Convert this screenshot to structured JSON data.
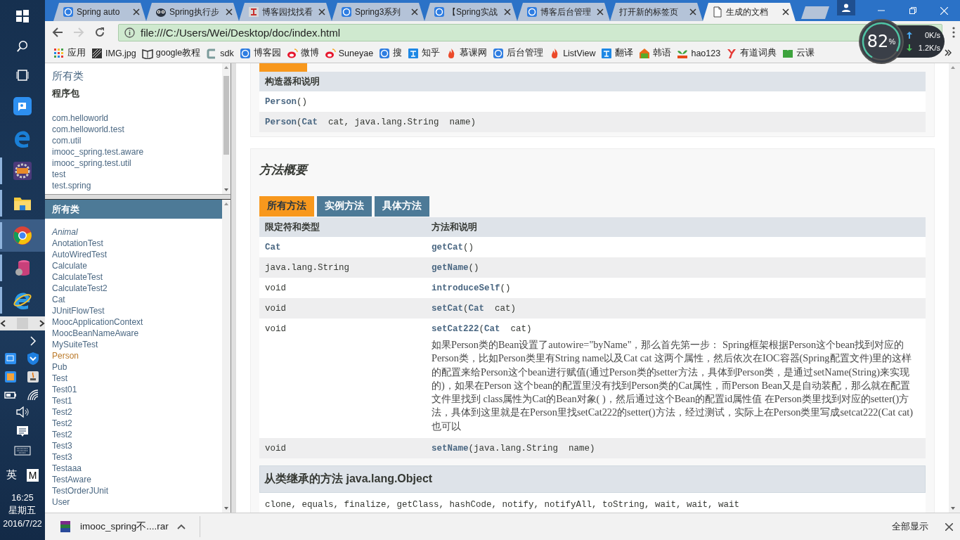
{
  "taskbar": {
    "apps": [
      {
        "running": false,
        "selected": false
      },
      {
        "running": false,
        "selected": false
      },
      {
        "running": true,
        "selected": false
      },
      {
        "running": true,
        "selected": false
      },
      {
        "running": true,
        "selected": true
      },
      {
        "running": true,
        "selected": false
      },
      {
        "running": true,
        "selected": false
      }
    ],
    "language": "英",
    "ime": "M",
    "time": "16:25",
    "weekday": "星期五",
    "date": "2016/7/22"
  },
  "tabs": [
    {
      "title": "Spring auto",
      "kind": "blog",
      "selected": false
    },
    {
      "title": "Spring执行步",
      "kind": "owl",
      "selected": false
    },
    {
      "title": "博客园找找看",
      "kind": "find",
      "selected": false
    },
    {
      "title": "Spring3系列",
      "kind": "blog",
      "selected": false
    },
    {
      "title": "【Spring实战",
      "kind": "blog",
      "selected": false
    },
    {
      "title": "博客后台管理",
      "kind": "blog",
      "selected": false
    },
    {
      "title": "打开新的标签页",
      "kind": "none",
      "selected": false
    },
    {
      "title": "生成的文档",
      "kind": "page",
      "selected": true
    }
  ],
  "address": {
    "value": "file:///C:/Users/Wei/Desktop/doc/index.html"
  },
  "bookmarks": [
    {
      "label": "应用",
      "kind": "apps"
    },
    {
      "label": "IMG.jpg",
      "kind": "image"
    },
    {
      "label": "google教程",
      "kind": "book"
    },
    {
      "label": "sdk",
      "kind": "bracket"
    },
    {
      "label": "博客园",
      "kind": "blog"
    },
    {
      "label": "微博",
      "kind": "eye"
    },
    {
      "label": "Suneyae",
      "kind": "eye"
    },
    {
      "label": "搜",
      "kind": "blog"
    },
    {
      "label": "知乎",
      "kind": "square"
    },
    {
      "label": "慕课网",
      "kind": "flame"
    },
    {
      "label": "后台管理",
      "kind": "blog"
    },
    {
      "label": "ListView",
      "kind": "flame"
    },
    {
      "label": "翻译",
      "kind": "square"
    },
    {
      "label": "韩语",
      "kind": "house"
    },
    {
      "label": "hao123",
      "kind": "leaf"
    },
    {
      "label": "有道词典",
      "kind": "y"
    },
    {
      "label": "云课",
      "kind": "greenbook"
    }
  ],
  "net_meter": {
    "percent": "82",
    "unit": "%",
    "upload": "0K/s",
    "download": "1.2K/s"
  },
  "package_frame": {
    "link": "所有类",
    "heading": "程序包",
    "packages": [
      "com.helloworld",
      "com.helloworld.test",
      "com.util",
      "imooc_spring.test.aware",
      "imooc_spring.test.util",
      "test",
      "test.spring"
    ]
  },
  "class_frame": {
    "heading": "所有类",
    "classes": [
      {
        "name": "Animal",
        "kind": "interface",
        "selected": false
      },
      {
        "name": "AnotationTest",
        "kind": "class",
        "selected": false
      },
      {
        "name": "AutoWiredTest",
        "kind": "class",
        "selected": false
      },
      {
        "name": "Calculate",
        "kind": "class",
        "selected": false
      },
      {
        "name": "CalculateTest",
        "kind": "class",
        "selected": false
      },
      {
        "name": "CalculateTest2",
        "kind": "class",
        "selected": false
      },
      {
        "name": "Cat",
        "kind": "class",
        "selected": false
      },
      {
        "name": "JUnitFlowTest",
        "kind": "class",
        "selected": false
      },
      {
        "name": "MoocApplicationContext",
        "kind": "class",
        "selected": false
      },
      {
        "name": "MoocBeanNameAware",
        "kind": "class",
        "selected": false
      },
      {
        "name": "MySuiteTest",
        "kind": "class",
        "selected": false
      },
      {
        "name": "Person",
        "kind": "class",
        "selected": true
      },
      {
        "name": "Pub",
        "kind": "class",
        "selected": false
      },
      {
        "name": "Test",
        "kind": "class",
        "selected": false
      },
      {
        "name": "Test01",
        "kind": "class",
        "selected": false
      },
      {
        "name": "Test1",
        "kind": "class",
        "selected": false
      },
      {
        "name": "Test2",
        "kind": "class",
        "selected": false
      },
      {
        "name": "Test2",
        "kind": "class",
        "selected": false
      },
      {
        "name": "Test2",
        "kind": "class",
        "selected": false
      },
      {
        "name": "Test3",
        "kind": "class",
        "selected": false
      },
      {
        "name": "Test3",
        "kind": "class",
        "selected": false
      },
      {
        "name": "Testaaa",
        "kind": "class",
        "selected": false
      },
      {
        "name": "TestAware",
        "kind": "class",
        "selected": false
      },
      {
        "name": "TestOrderJUnit",
        "kind": "class",
        "selected": false
      },
      {
        "name": "User",
        "kind": "class",
        "selected": false
      }
    ]
  },
  "constructors": {
    "header": "构造器和说明",
    "rows": [
      "**Person**()",
      "**Person**(**Cat**  cat, java.lang.String  name)"
    ]
  },
  "method_summary": {
    "title": "方法概要",
    "tabs": [
      {
        "label": "所有方法",
        "selected": true
      },
      {
        "label": "实例方法",
        "selected": false
      },
      {
        "label": "具体方法",
        "selected": false
      }
    ],
    "columns": [
      "限定符和类型",
      "方法和说明"
    ],
    "rows": [
      {
        "modifier": "**Cat**",
        "signature": "**getCat**()"
      },
      {
        "modifier": "java.lang.String",
        "signature": "**getName**()"
      },
      {
        "modifier": "void",
        "signature": "**introduceSelf**()"
      },
      {
        "modifier": "void",
        "signature": "**setCat**(**Cat**  cat)"
      },
      {
        "modifier": "void",
        "signature": "**setCat222**(**Cat**  cat)",
        "description": "如果Person类的Bean设置了autowire=\"byName\"，那么首先第一步： Spring框架根据Person这个bean找到对应的Person类，比如Person类里有String name以及Cat cat 这两个属性，然后依次在IOC容器(Spring配置文件)里的这样的配置来给Person这个bean进行赋值(通过Person类的setter方法，具体到Person类，是通过setName(String)来实现的)，如果在Person 这个bean的配置里没有找到Person类的Cat属性，而Person Bean又是自动装配，那么就在配置文件里找到 class属性为Cat的Bean对象( )，然后通过这个Bean的配置id属性值 在Person类里找到对应的setter()方法，具体到这里就是在Person里找setCat222的setter()方法，经过测试，实际上在Person类里写成setcat222(Cat cat)也可以"
      },
      {
        "modifier": "void",
        "signature": "**setName**(java.lang.String  name)"
      }
    ]
  },
  "inherited": {
    "title": "从类继承的方法 java.lang.Object",
    "methods": "clone, equals, finalize, getClass, hashCode, notify, notifyAll, toString, wait, wait, wait"
  },
  "download_bar": {
    "file": "imooc_spring不....rar",
    "show_all": "全部显示"
  }
}
